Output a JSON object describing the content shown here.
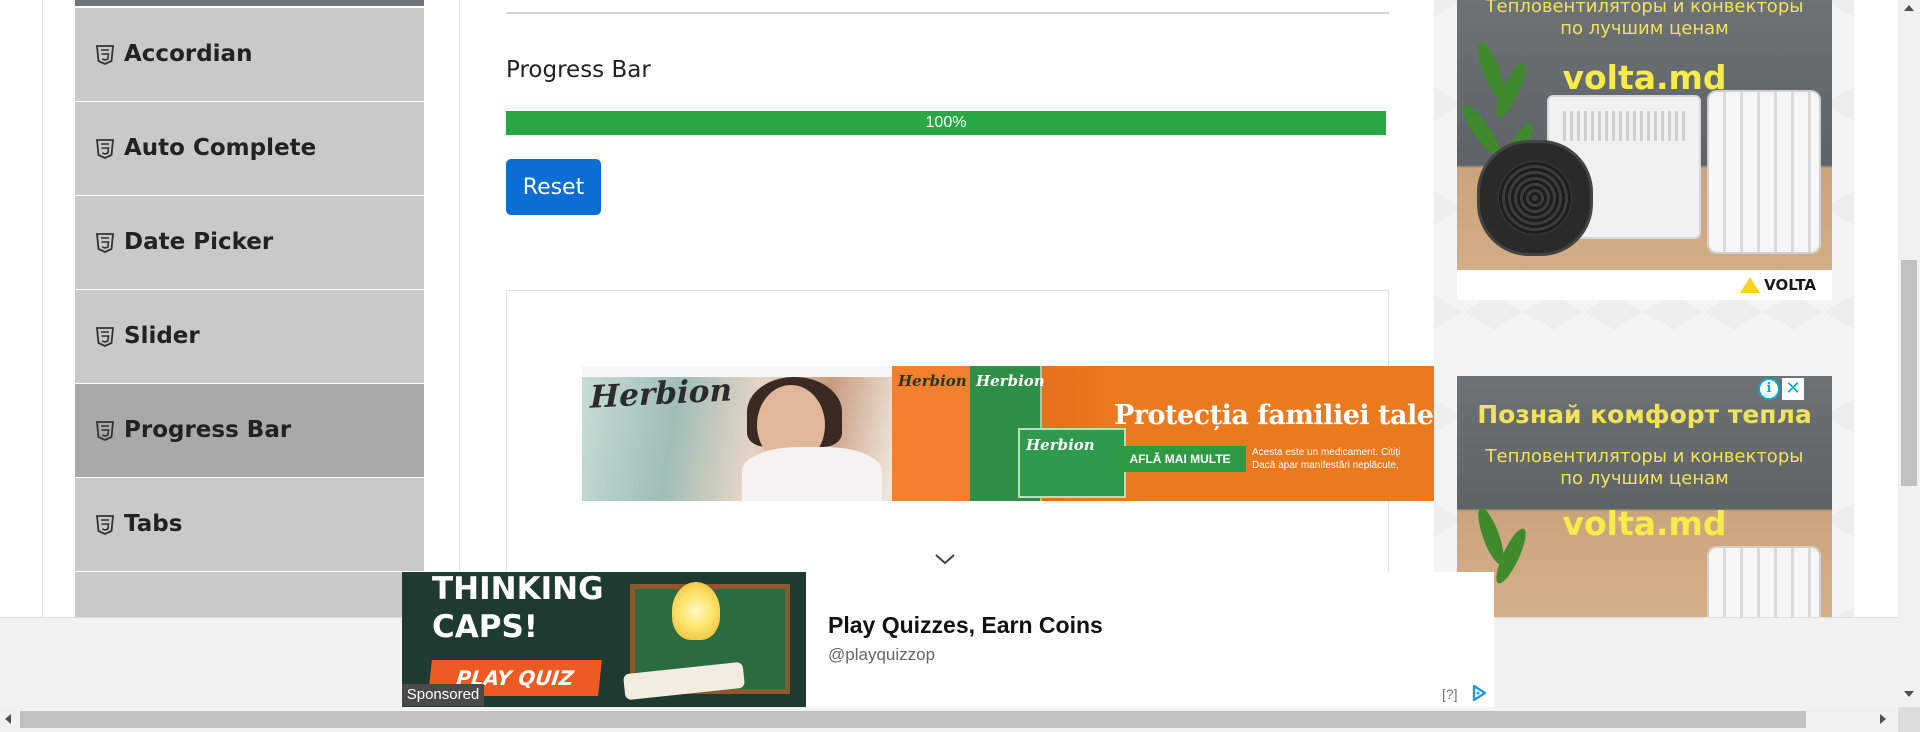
{
  "sidebar": {
    "items": [
      {
        "label": "Accordian",
        "active": false
      },
      {
        "label": "Auto Complete",
        "active": false
      },
      {
        "label": "Date Picker",
        "active": false
      },
      {
        "label": "Slider",
        "active": false
      },
      {
        "label": "Progress Bar",
        "active": true
      },
      {
        "label": "Tabs",
        "active": false
      }
    ],
    "icon": "html5-icon"
  },
  "main": {
    "title": "Progress Bar",
    "progress": {
      "value_percent": 100,
      "label": "100%",
      "color": "#28a745"
    },
    "reset_label": "Reset",
    "reset_color": "#0a6ed3"
  },
  "ads": {
    "herbion": {
      "brand": "Herbion",
      "product_labels": [
        "Herbion",
        "Herbion",
        "Herbion"
      ],
      "headline": "Protecția familiei tale împotriv",
      "cta": "AFLĂ MAI MULTE",
      "small_lines": [
        "Acesta este un medicament. Citiți",
        "Dacă apar manifestări neplăcute,"
      ]
    },
    "volta_top": {
      "headline": "",
      "sub_lines": [
        "Тепловентиляторы и конвекторы",
        "по лучшим ценам"
      ],
      "brand": "volta.md",
      "logo": "VOLTA"
    },
    "volta_bottom": {
      "headline": "Познай комфорт тепла",
      "sub_lines": [
        "Тепловентиляторы и конвекторы",
        "по лучшим ценам"
      ],
      "brand": "volta.md"
    },
    "sticky": {
      "image_title_lines": [
        "THINKING",
        "CAPS!"
      ],
      "image_button": "PLAY QUIZ",
      "sponsored": "Sponsored",
      "headline": "Play Quizzes, Earn Coins",
      "handle": "@playquizzop",
      "help": "[?]"
    }
  },
  "colors": {
    "sidebar_item": "#c9c9c9",
    "sidebar_active": "#a9a9a9",
    "ad_orange": "#ea7a1f",
    "volta_yellow": "#f2e35a"
  }
}
